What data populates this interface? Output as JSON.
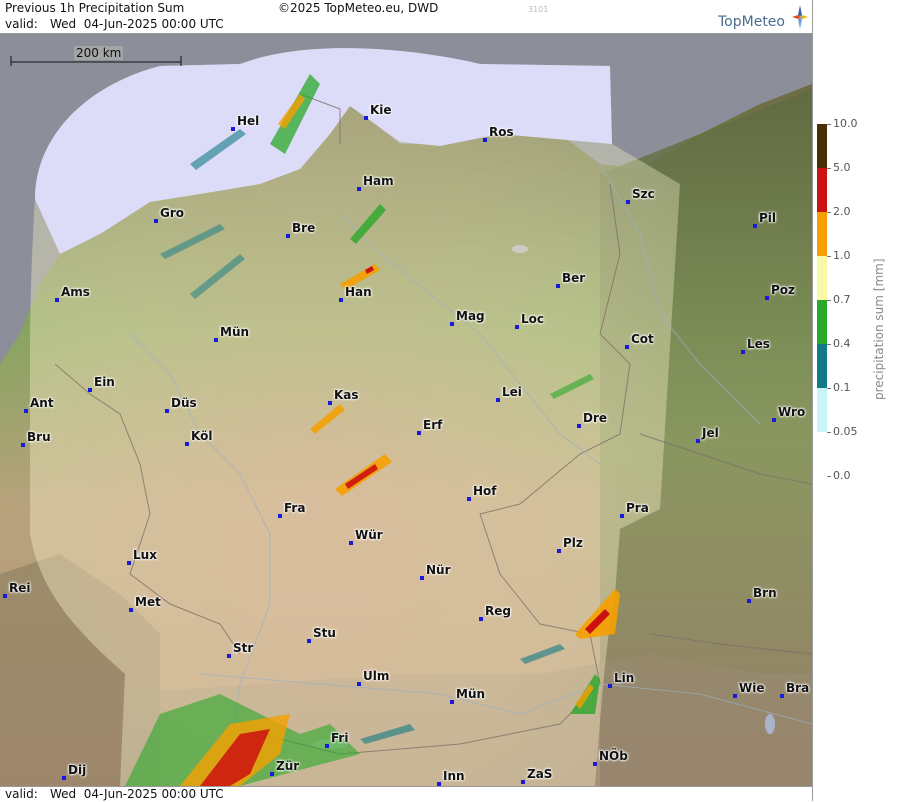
{
  "header": {
    "title": "Previous 1h Precipitation Sum",
    "copyright": "©2025 TopMeteo.eu, DWD",
    "valid_label": "valid:",
    "valid_time": "Wed  04-Jun-2025 00:00 UTC",
    "id_code": "3101",
    "logo_text": "TopMeteo"
  },
  "footer": {
    "valid_label": "valid:",
    "valid_time": "Wed  04-Jun-2025 00:00 UTC"
  },
  "scale": {
    "label": "200 km"
  },
  "legend": {
    "title": "precipitation sum [mm]",
    "levels": [
      {
        "label": "10.0",
        "color": "#4a2e08"
      },
      {
        "label": "5.0",
        "color": "#cc1111"
      },
      {
        "label": "2.0",
        "color": "#f5a000"
      },
      {
        "label": "1.0",
        "color": "#f8f8a8"
      },
      {
        "label": "0.7",
        "color": "#2aa82a"
      },
      {
        "label": "0.4",
        "color": "#127a86"
      },
      {
        "label": "0.1",
        "color": "#c9f3f6"
      },
      {
        "label": "0.05",
        "color": ""
      },
      {
        "label": "0.0",
        "color": ""
      }
    ]
  },
  "cities": [
    {
      "name": "Hel"
    },
    {
      "name": "Kie"
    },
    {
      "name": "Ros"
    },
    {
      "name": "Ham"
    },
    {
      "name": "Szc"
    },
    {
      "name": "Gro"
    },
    {
      "name": "Bre"
    },
    {
      "name": "Pil"
    },
    {
      "name": "Ams"
    },
    {
      "name": "Han"
    },
    {
      "name": "Ber"
    },
    {
      "name": "Poz"
    },
    {
      "name": "Mag"
    },
    {
      "name": "Loc"
    },
    {
      "name": "Mün"
    },
    {
      "name": "Cot"
    },
    {
      "name": "Les"
    },
    {
      "name": "Ein"
    },
    {
      "name": "Kas"
    },
    {
      "name": "Lei"
    },
    {
      "name": "Ant"
    },
    {
      "name": "Düs"
    },
    {
      "name": "Wro"
    },
    {
      "name": "Bru"
    },
    {
      "name": "Köl"
    },
    {
      "name": "Erf"
    },
    {
      "name": "Dre"
    },
    {
      "name": "Jel"
    },
    {
      "name": "Hof"
    },
    {
      "name": "Fra"
    },
    {
      "name": "Pra"
    },
    {
      "name": "Wür"
    },
    {
      "name": "Plz"
    },
    {
      "name": "Lux"
    },
    {
      "name": "Nür"
    },
    {
      "name": "Rei"
    },
    {
      "name": "Met"
    },
    {
      "name": "Reg"
    },
    {
      "name": "Brn"
    },
    {
      "name": "Stu"
    },
    {
      "name": "Str"
    },
    {
      "name": "Ulm"
    },
    {
      "name": "Lin"
    },
    {
      "name": "Mün"
    },
    {
      "name": "Wie"
    },
    {
      "name": "Bra"
    },
    {
      "name": "Fri"
    },
    {
      "name": "NÖb"
    },
    {
      "name": "Dij"
    },
    {
      "name": "Zür"
    },
    {
      "name": "Inn"
    },
    {
      "name": "ZaS"
    }
  ],
  "colors": {
    "sea": "#8c8f99",
    "coverage_sea": "#dcdcf8",
    "coverage_land": "#f6f0c8",
    "dot": "#1a1adb"
  }
}
